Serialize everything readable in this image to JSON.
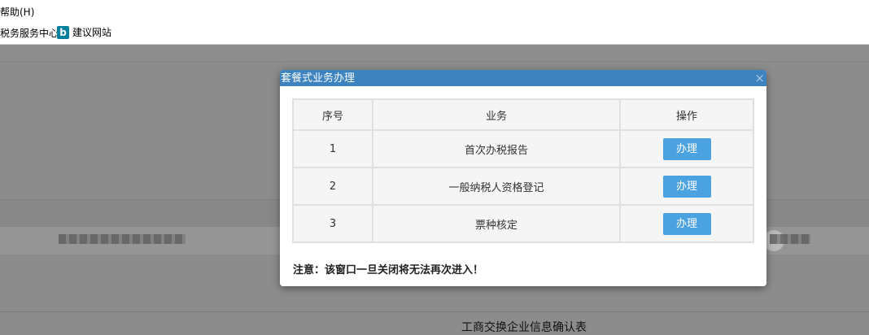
{
  "menubar": {
    "help": "帮助(H)"
  },
  "favorites": {
    "item1": "税务服务中心",
    "item2": "建议网站",
    "item2_icon": "bing-icon"
  },
  "page": {
    "bottom_text": "工商交换企业信息确认表"
  },
  "dialog": {
    "title": "套餐式业务办理",
    "close_glyph": "×",
    "table": {
      "headers": [
        "序号",
        "业务",
        "操作"
      ],
      "rows": [
        {
          "no": "1",
          "business": "首次办税报告",
          "action": "办理"
        },
        {
          "no": "2",
          "business": "一般纳税人资格登记",
          "action": "办理"
        },
        {
          "no": "3",
          "business": "票种核定",
          "action": "办理"
        }
      ]
    },
    "notice": "注意：该窗口一旦关闭将无法再次进入！"
  },
  "colors": {
    "header_blue": "#3c83c0",
    "button_blue": "#4ba2e0"
  }
}
